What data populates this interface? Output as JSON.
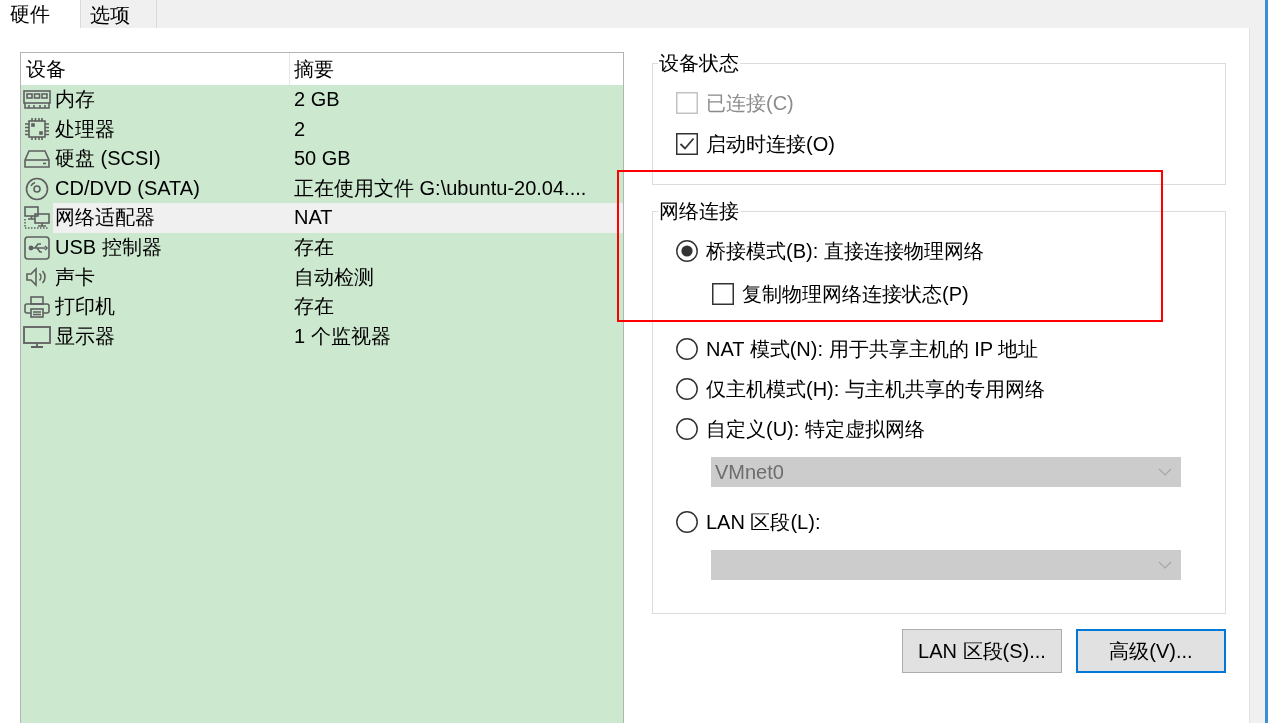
{
  "tabs": [
    {
      "label": "硬件",
      "selected": true
    },
    {
      "label": "选项",
      "selected": false
    }
  ],
  "device_list": {
    "columns": [
      "设备",
      "摘要"
    ],
    "rows": [
      {
        "kind": "memory",
        "device": "内存",
        "summary": "2 GB",
        "selected": false
      },
      {
        "kind": "processor",
        "device": "处理器",
        "summary": "2",
        "selected": false
      },
      {
        "kind": "hard_disk",
        "device": "硬盘 (SCSI)",
        "summary": "50 GB",
        "selected": false
      },
      {
        "kind": "cd_dvd",
        "device": "CD/DVD (SATA)",
        "summary": "正在使用文件 G:\\ubuntu-20.04....",
        "selected": false
      },
      {
        "kind": "network",
        "device": "网络适配器",
        "summary": "NAT",
        "selected": true
      },
      {
        "kind": "usb",
        "device": "USB 控制器",
        "summary": "存在",
        "selected": false
      },
      {
        "kind": "sound",
        "device": "声卡",
        "summary": "自动检测",
        "selected": false
      },
      {
        "kind": "printer",
        "device": "打印机",
        "summary": "存在",
        "selected": false
      },
      {
        "kind": "display",
        "device": "显示器",
        "summary": "1 个监视器",
        "selected": false
      }
    ]
  },
  "device_status": {
    "title": "设备状态",
    "options": [
      {
        "label": "已连接(C)",
        "checked": false,
        "disabled": true
      },
      {
        "label": "启动时连接(O)",
        "checked": true,
        "disabled": false
      }
    ]
  },
  "network_connection": {
    "title": "网络连接",
    "options": [
      {
        "kind": "radio",
        "label": "桥接模式(B): 直接连接物理网络",
        "selected": true
      },
      {
        "kind": "checkbox",
        "label": "复制物理网络连接状态(P)",
        "checked": false
      },
      {
        "kind": "radio",
        "label": "NAT 模式(N): 用于共享主机的 IP 地址",
        "selected": false
      },
      {
        "kind": "radio",
        "label": "仅主机模式(H): 与主机共享的专用网络",
        "selected": false
      },
      {
        "kind": "radio",
        "label": "自定义(U): 特定虚拟网络",
        "selected": false
      },
      {
        "kind": "dropdown",
        "value": "VMnet0",
        "disabled": true
      },
      {
        "kind": "radio",
        "label": "LAN 区段(L):",
        "selected": false
      },
      {
        "kind": "dropdown",
        "disabled": true
      }
    ]
  },
  "buttons": [
    {
      "label": "LAN 区段(S)...",
      "default": false
    },
    {
      "label": "高级(V)...",
      "default": true
    }
  ],
  "annotations": [
    {
      "kind": "rectangle"
    }
  ]
}
